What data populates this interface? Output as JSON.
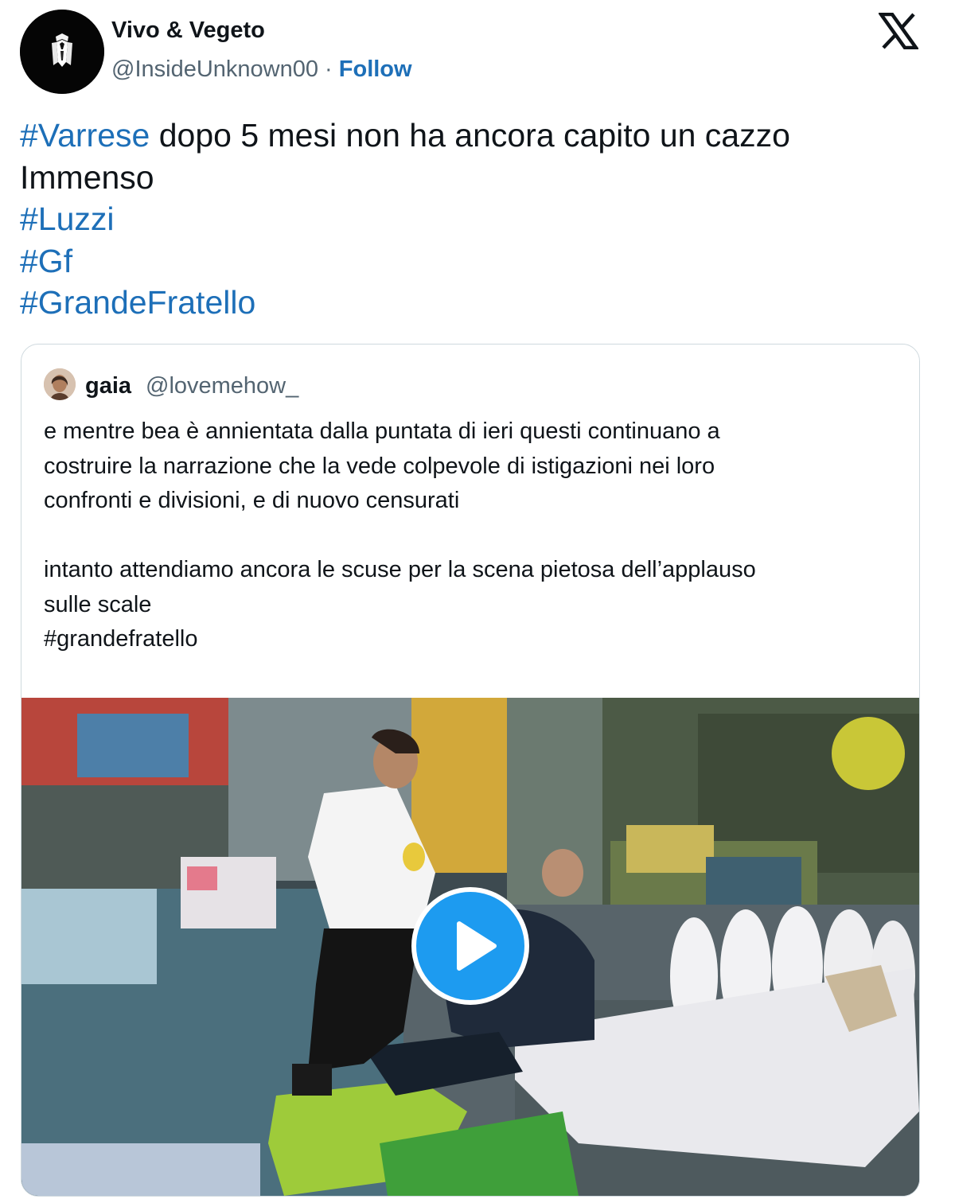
{
  "author": {
    "name": "Vivo & Vegeto",
    "handle": "@InsideUnknown00",
    "separator": " · ",
    "follow_label": "Follow",
    "avatar_icon": "tuxedo-figure-icon"
  },
  "platform_icon": "x-logo-icon",
  "tweet": {
    "lines": [
      [
        {
          "text": "#Varrese",
          "hashtag": true
        },
        {
          "text": " dopo 5 mesi non ha ancora capito un cazzo",
          "hashtag": false
        }
      ],
      [
        {
          "text": "Immenso",
          "hashtag": false
        }
      ],
      [
        {
          "text": "#Luzzi",
          "hashtag": true
        }
      ],
      [
        {
          "text": "#Gf",
          "hashtag": true
        }
      ],
      [
        {
          "text": "#GrandeFratello",
          "hashtag": true
        }
      ]
    ]
  },
  "quoted": {
    "name": "gaia",
    "handle": "@lovemehow_",
    "avatar_icon": "profile-photo-icon",
    "lines": [
      "e mentre bea è annientata dalla puntata di ieri questi continuano a",
      "costruire la narrazione che la vede colpevole di istigazioni nei loro",
      "confronti e divisioni, e di nuovo censurati",
      "",
      "intanto attendiamo ancora le scuse per la scena pietosa dell’applauso",
      "sulle scale",
      "#grandefratello"
    ],
    "video": {
      "play_icon": "play-icon"
    }
  },
  "colors": {
    "link": "#1d6fb8",
    "text": "#0f1419",
    "secondary": "#536471",
    "border": "#cfd9de",
    "play_button": "#1d9bf0"
  }
}
